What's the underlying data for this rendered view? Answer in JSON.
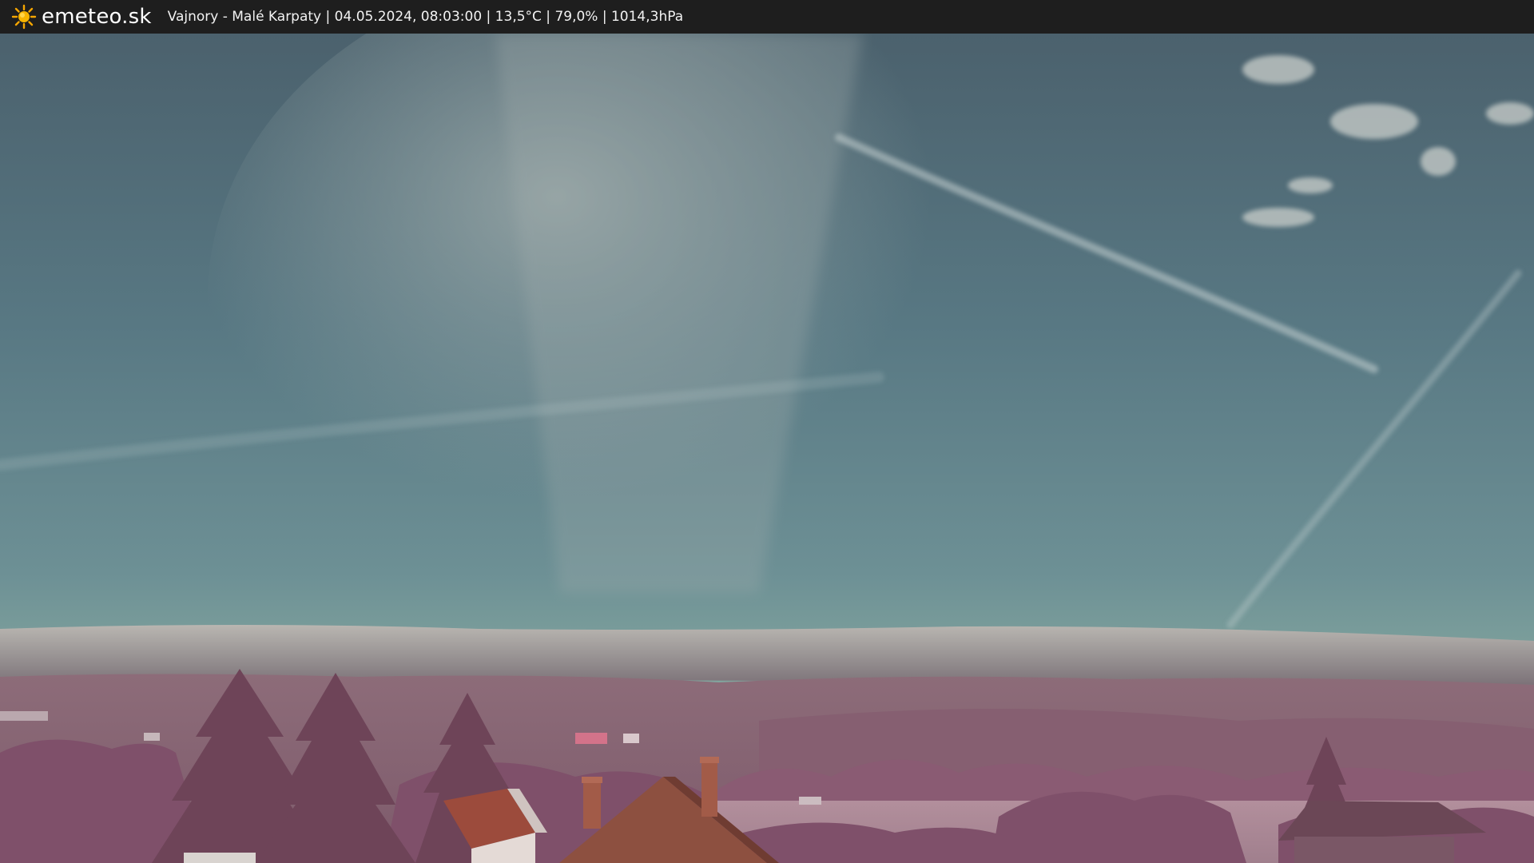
{
  "header": {
    "brand": "emeteo.sk",
    "caption": "Vajnory - Malé Karpaty | 04.05.2024, 08:03:00 | 13,5°C | 79,0% | 1014,3hPa",
    "brand_icon": "sun-icon"
  },
  "scene": {
    "description_colors": {
      "sky_top": "#4e6672",
      "sky_mid": "#6a8a92",
      "sky_low": "#7fa39c",
      "cloud_band": "#a9a6a4",
      "hills": "#8e6778",
      "foliage": "#8a5a72",
      "roof": "#9a4f3e"
    }
  }
}
